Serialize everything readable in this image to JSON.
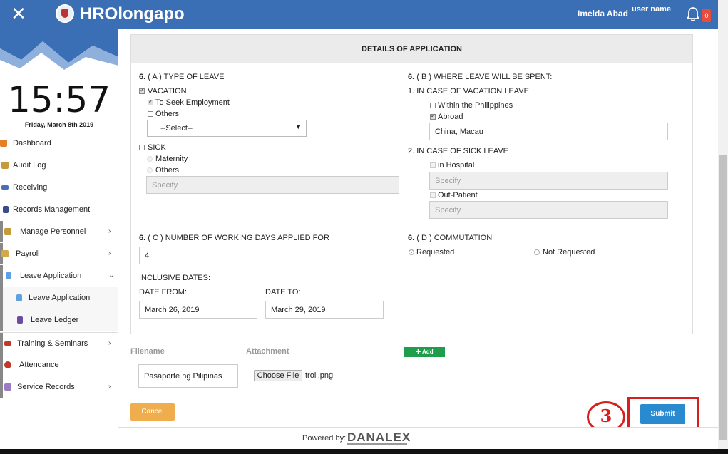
{
  "header": {
    "brand": "HROlongapo",
    "user_name": "Imelda Abad",
    "user_image_alt": "user name",
    "notification_count": "0",
    "colors": {
      "bar": "#3a6fb5"
    }
  },
  "sidebar": {
    "clock_time": "15:57",
    "clock_date": "Friday, March 8th 2019",
    "items": [
      {
        "label": "Dashboard",
        "icon": "dashboard-icon"
      },
      {
        "label": "Audit Log",
        "icon": "audit-log-icon"
      },
      {
        "label": "Receiving",
        "icon": "receiving-icon"
      },
      {
        "label": "Records Management",
        "icon": "records-icon"
      },
      {
        "label": "Manage Personnel",
        "icon": "personnel-icon",
        "chevron": "›"
      },
      {
        "label": "Payroll",
        "icon": "payroll-icon",
        "chevron": "›"
      },
      {
        "label": "Leave Application",
        "icon": "leave-icon",
        "chevron": "⌄"
      },
      {
        "label": "Leave Application",
        "icon": "leave-doc-icon"
      },
      {
        "label": "Leave Ledger",
        "icon": "ledger-icon"
      },
      {
        "label": "Training & Seminars",
        "icon": "training-icon",
        "chevron": "›"
      },
      {
        "label": "Attendance",
        "icon": "attendance-icon"
      },
      {
        "label": "Service Records",
        "icon": "service-records-icon",
        "chevron": "›"
      }
    ]
  },
  "form": {
    "section_title": "DETAILS OF APPLICATION",
    "type_of_leave": {
      "num": "6.",
      "label": "( A ) TYPE OF LEAVE",
      "vacation": "VACATION",
      "seek_employment": "To Seek Employment",
      "others": "Others",
      "select_value": "--Select--",
      "sick": "SICK",
      "maternity": "Maternity",
      "sick_others": "Others",
      "specify_placeholder": "Specify"
    },
    "where_spent": {
      "num": "6.",
      "label": "( B ) WHERE LEAVE WILL BE SPENT:",
      "vacation_case": "1. IN CASE OF VACATION LEAVE",
      "within_ph": "Within the Philippines",
      "abroad": "Abroad",
      "abroad_value": "China, Macau",
      "sick_case": "2. IN CASE OF SICK LEAVE",
      "in_hospital": "in Hospital",
      "hospital_placeholder": "Specify",
      "out_patient": "Out-Patient",
      "outpatient_placeholder": "Specify"
    },
    "working_days": {
      "num": "6.",
      "label": "( C ) NUMBER OF WORKING DAYS APPLIED FOR",
      "value": "4",
      "inclusive_dates": "INCLUSIVE DATES:",
      "date_from_label": "DATE FROM:",
      "date_from_value": "March 26, 2019",
      "date_to_label": "DATE TO:",
      "date_to_value": "March 29, 2019"
    },
    "commutation": {
      "num": "6.",
      "label": "( D ) COMMUTATION",
      "requested": "Requested",
      "not_requested": "Not Requested"
    },
    "attachments": {
      "filename_header": "Filename",
      "attachment_header": "Attachment",
      "add_label": "Add",
      "filename_value": "Pasaporte ng Pilipinas",
      "choose_file_label": "Choose File",
      "chosen_file": "troll.png"
    },
    "cancel_label": "Cancel",
    "submit_label": "Submit",
    "step_marker": "3"
  },
  "footer": {
    "powered_by": "Powered by:",
    "vendor": "DANALEX"
  }
}
